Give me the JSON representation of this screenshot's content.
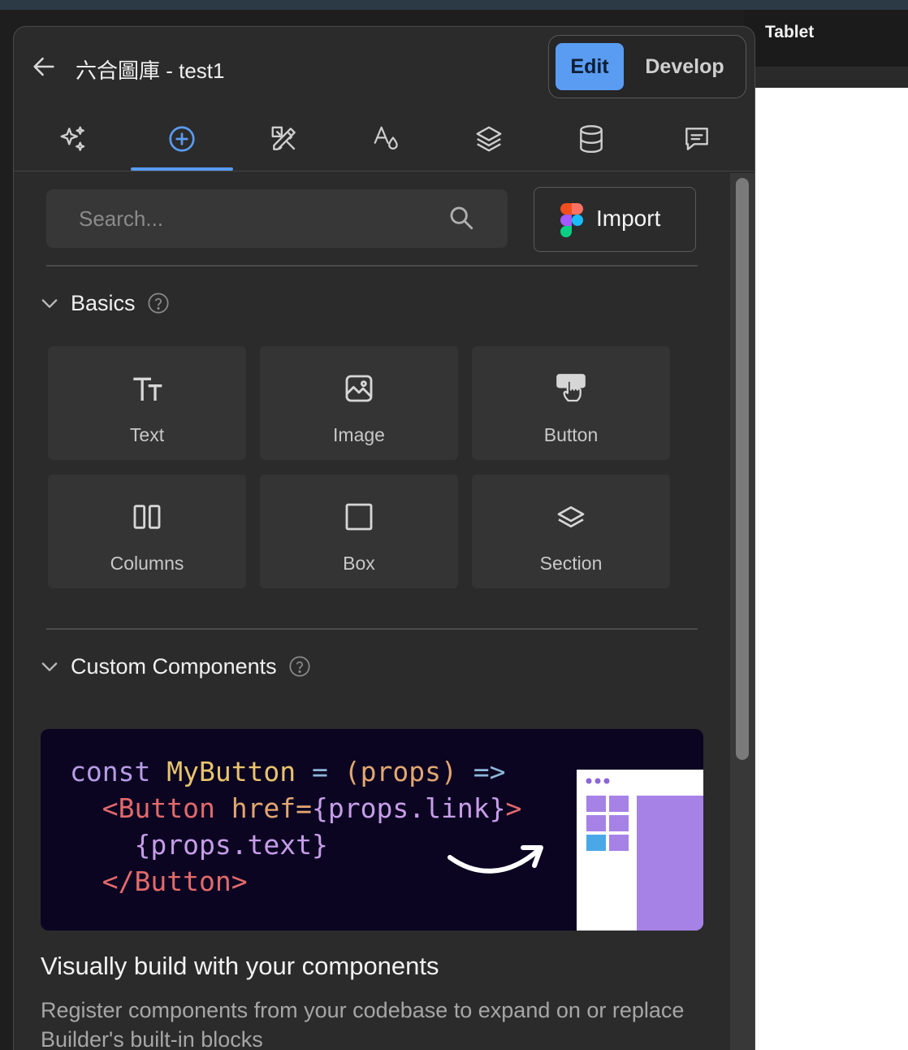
{
  "window": {
    "tablet_label": "Tablet"
  },
  "header": {
    "title": "六合圖庫 - test1",
    "modes": {
      "edit": "Edit",
      "develop": "Develop"
    },
    "active_mode": "Edit"
  },
  "tabs": [
    {
      "name": "ai",
      "icon": "sparkles-icon"
    },
    {
      "name": "insert",
      "icon": "plus-circle-icon",
      "active": true
    },
    {
      "name": "style",
      "icon": "design-tools-icon"
    },
    {
      "name": "typography",
      "icon": "font-color-icon"
    },
    {
      "name": "layers",
      "icon": "layers-icon"
    },
    {
      "name": "data",
      "icon": "database-icon"
    },
    {
      "name": "comments",
      "icon": "comment-icon"
    }
  ],
  "search": {
    "placeholder": "Search..."
  },
  "import": {
    "label": "Import",
    "icon": "figma-icon"
  },
  "basics": {
    "title": "Basics",
    "blocks": [
      {
        "label": "Text",
        "icon": "text-icon"
      },
      {
        "label": "Image",
        "icon": "image-icon"
      },
      {
        "label": "Button",
        "icon": "button-icon"
      },
      {
        "label": "Columns",
        "icon": "columns-icon"
      },
      {
        "label": "Box",
        "icon": "box-icon"
      },
      {
        "label": "Section",
        "icon": "section-icon"
      }
    ]
  },
  "custom": {
    "title": "Custom Components",
    "code": {
      "l1_kw": "const",
      "l1_fn": "MyButton",
      "l1_eq": " = ",
      "l1_arg": "(props)",
      "l1_arrow": " =>",
      "l2_tag": "<Button",
      "l2_attr": " href=",
      "l2_val": "{props.link}",
      "l2_end": ">",
      "l3": "{props.text}",
      "l4": "</Button>"
    },
    "promo_title": "Visually build with your components",
    "promo_desc": "Register components from your codebase to expand on or replace Builder's built-in blocks"
  },
  "colors": {
    "accent": "#5a9cf2",
    "panel": "#2b2b2b",
    "promo_bg": "#0b0522",
    "mock_purple": "#a681e6"
  }
}
